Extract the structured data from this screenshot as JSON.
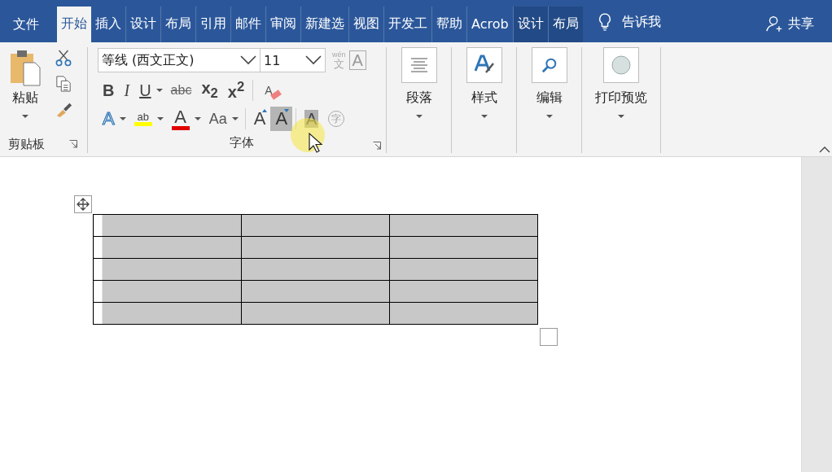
{
  "tabs": [
    {
      "label": "文件",
      "kind": "file",
      "selected": false
    },
    {
      "label": "开始",
      "kind": "tab",
      "selected": true
    },
    {
      "label": "插入",
      "kind": "tab",
      "selected": false
    },
    {
      "label": "设计",
      "kind": "tab",
      "selected": false
    },
    {
      "label": "布局",
      "kind": "tab",
      "selected": false
    },
    {
      "label": "引用",
      "kind": "tab",
      "selected": false
    },
    {
      "label": "邮件",
      "kind": "tab",
      "selected": false
    },
    {
      "label": "审阅",
      "kind": "tab",
      "selected": false
    },
    {
      "label": "新建选",
      "kind": "tab",
      "selected": false
    },
    {
      "label": "视图",
      "kind": "tab",
      "selected": false
    },
    {
      "label": "开发工",
      "kind": "tab",
      "selected": false
    },
    {
      "label": "帮助",
      "kind": "tab",
      "selected": false
    },
    {
      "label": "Acrob",
      "kind": "tab",
      "selected": false
    },
    {
      "label": "设计",
      "kind": "context",
      "selected": false
    },
    {
      "label": "布局",
      "kind": "context",
      "selected": false
    }
  ],
  "tell_me": "告诉我",
  "share": "共享",
  "clipboard": {
    "paste": "粘贴",
    "label": "剪贴板"
  },
  "font": {
    "label": "字体",
    "font_name": "等线 (西文正文)",
    "font_size": "11",
    "row1": [
      {
        "kind": "bold",
        "glyph": "B",
        "dropdown": false
      },
      {
        "kind": "italic",
        "glyph": "I",
        "dropdown": false
      },
      {
        "kind": "underline",
        "glyph": "U",
        "dropdown": true
      },
      {
        "kind": "strike",
        "glyph": "abc",
        "dropdown": false
      },
      {
        "kind": "sub",
        "glyph": "x",
        "index": "2",
        "dropdown": false
      },
      {
        "kind": "sup",
        "glyph": "x",
        "index": "2",
        "dropdown": false
      },
      {
        "kind": "clear",
        "glyph": "A",
        "dropdown": false
      }
    ],
    "row2": [
      {
        "kind": "effect",
        "glyph": "A",
        "dropdown": true,
        "highlighted": false
      },
      {
        "kind": "highlight",
        "glyph": "ab",
        "dropdown": true,
        "highlighted": false
      },
      {
        "kind": "color",
        "glyph": "A",
        "dropdown": true,
        "highlighted": false
      },
      {
        "kind": "case",
        "glyph": "Aa",
        "dropdown": true,
        "highlighted": false
      },
      {
        "kind": "grow",
        "glyph": "A",
        "dropdown": false,
        "highlighted": false
      },
      {
        "kind": "shrink",
        "glyph": "A",
        "dropdown": false,
        "highlighted": true
      },
      {
        "kind": "shading",
        "glyph": "A",
        "dropdown": false,
        "highlighted": false
      },
      {
        "kind": "enclose",
        "glyph": "字",
        "dropdown": false,
        "highlighted": false
      }
    ],
    "phonetic": {
      "ruby": "wén",
      "glyph": "文"
    },
    "border_glyph": "A"
  },
  "groups": [
    {
      "kind": "paragraph",
      "label": "段落"
    },
    {
      "kind": "styles",
      "label": "样式"
    },
    {
      "kind": "editing",
      "label": "编辑"
    },
    {
      "kind": "print",
      "label": "打印预览"
    }
  ],
  "table": {
    "rows": [
      {
        "cells": [
          {
            "selected": true
          },
          {
            "selected": true
          },
          {
            "selected": true
          }
        ]
      },
      {
        "cells": [
          {
            "selected": true
          },
          {
            "selected": true
          },
          {
            "selected": true
          }
        ]
      },
      {
        "cells": [
          {
            "selected": true
          },
          {
            "selected": true
          },
          {
            "selected": true
          }
        ]
      },
      {
        "cells": [
          {
            "selected": true
          },
          {
            "selected": true
          },
          {
            "selected": true
          }
        ]
      },
      {
        "cells": [
          {
            "selected": true
          },
          {
            "selected": true
          },
          {
            "selected": true
          }
        ]
      }
    ]
  }
}
